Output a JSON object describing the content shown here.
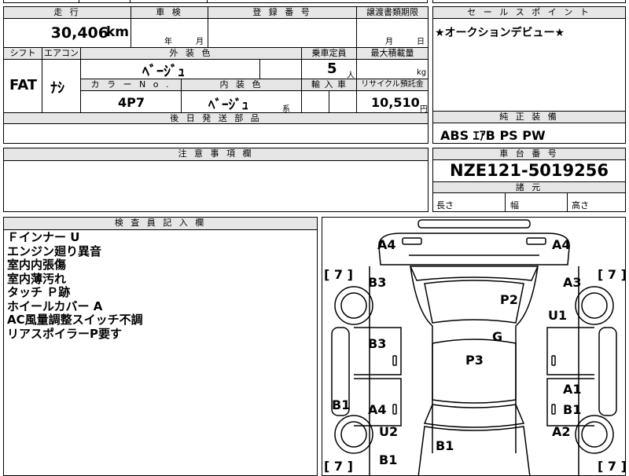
{
  "left_table": {
    "headers": {
      "mileage": "走 行",
      "inspection": "車 検",
      "registration": "登 録 番 号",
      "transfer_docs": "譲渡書類期限",
      "shift": "シフト",
      "aircon": "エアコン",
      "exterior_color": "外 装 色",
      "capacity": "乗車定員",
      "max_load": "最大積載量",
      "color_no": "カ ラ ー N o .",
      "interior_color": "内 装 色",
      "import": "輸 入 車",
      "recycle": "リサイクル預託金",
      "later_parts": "後 日 発 送 部 品"
    },
    "values": {
      "mileage": "30,406",
      "mileage_unit": "km",
      "inspection_year": "年",
      "inspection_month": "月",
      "transfer_month": "月",
      "transfer_day": "日",
      "shift": "FAT",
      "aircon": "ﾅｼ",
      "exterior_color": "ﾍﾞｰｼﾞｭ",
      "capacity": "5",
      "capacity_unit": "人",
      "max_load_unit": "kg",
      "color_no": "4P7",
      "interior_color": "ﾍﾞｰｼﾞｭ",
      "interior_suffix": "系",
      "recycle": "10,510",
      "recycle_unit": "円"
    }
  },
  "sales_points": {
    "header": "セ ー ル ス ポ イ ン ト",
    "text": "★オークションデビュー★"
  },
  "equipment": {
    "header": "純 正 装 備",
    "text": "ABS ｴｱB PS PW"
  },
  "cautions": {
    "header": "注 意 事 項 欄"
  },
  "chassis": {
    "header": "車 台 番 号",
    "number": "NZE121-5019256",
    "dims_header": "諸 元",
    "length_label": "長さ",
    "width_label": "幅",
    "height_label": "高さ"
  },
  "inspector": {
    "header": "検 査 員 記 入 欄",
    "notes": [
      "Ｆインナー U",
      "エンジン廻り異音",
      "室内内張傷",
      "室内薄汚れ",
      "タッチ Ｐ跡",
      "ホイールカバー A",
      "AC風量調整スイッチ不調",
      "リアスポイラーP要す"
    ]
  },
  "diagram": {
    "marks": {
      "a4_front_left": "A4",
      "a4_front_right": "A4",
      "b3_upper": "B3",
      "a3": "A3",
      "p2": "P2",
      "u1": "U1",
      "g": "G",
      "b3_lower": "B3",
      "p3": "P3",
      "a1": "A1",
      "b1_door": "B1",
      "b1_left": "B1",
      "a4_rear": "A4",
      "u2": "U2",
      "a2": "A2",
      "b1_trunk": "B1",
      "b1_rear": "B1"
    },
    "tire_marks": [
      "[ 7 ]",
      "[ 7 ]",
      "[ 7 ]",
      "[ 7 ]"
    ]
  }
}
